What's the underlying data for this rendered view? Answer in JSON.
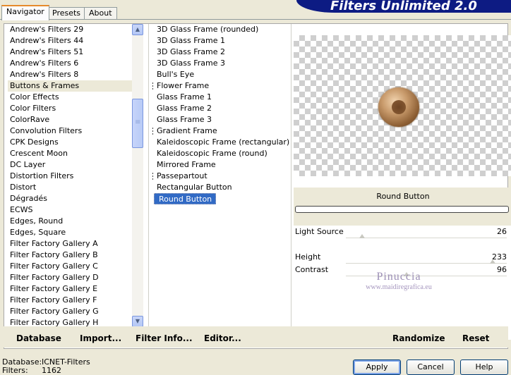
{
  "tabs": [
    {
      "label": "Navigator",
      "active": true
    },
    {
      "label": "Presets",
      "active": false
    },
    {
      "label": "About",
      "active": false
    }
  ],
  "banner": {
    "title": "Filters Unlimited 2.0"
  },
  "categories": {
    "items": [
      "Andrew's Filters 29",
      "Andrew's Filters 44",
      "Andrew's Filters 51",
      "Andrew's Filters 6",
      "Andrew's Filters 8",
      "Buttons & Frames",
      "Color Effects",
      "Color Filters",
      "ColorRave",
      "Convolution Filters",
      "CPK Designs",
      "Crescent Moon",
      "DC Layer",
      "Distortion Filters",
      "Distort",
      "Dégradés",
      "ECWS",
      "Edges, Round",
      "Edges, Square",
      "Filter Factory Gallery A",
      "Filter Factory Gallery B",
      "Filter Factory Gallery C",
      "Filter Factory Gallery D",
      "Filter Factory Gallery E",
      "Filter Factory Gallery F",
      "Filter Factory Gallery G",
      "Filter Factory Gallery H"
    ],
    "selected_index": 5
  },
  "filters": {
    "items": [
      {
        "label": "3D Glass Frame (rounded)",
        "marker": false
      },
      {
        "label": "3D Glass Frame 1",
        "marker": false
      },
      {
        "label": "3D Glass Frame 2",
        "marker": false
      },
      {
        "label": "3D Glass Frame 3",
        "marker": false
      },
      {
        "label": "Bull's Eye",
        "marker": false
      },
      {
        "label": "Flower Frame",
        "marker": true
      },
      {
        "label": "Glass Frame 1",
        "marker": false
      },
      {
        "label": "Glass Frame 2",
        "marker": false
      },
      {
        "label": "Glass Frame 3",
        "marker": false
      },
      {
        "label": "Gradient Frame",
        "marker": true
      },
      {
        "label": "Kaleidoscopic Frame (rectangular)",
        "marker": false
      },
      {
        "label": "Kaleidoscopic Frame (round)",
        "marker": false
      },
      {
        "label": "Mirrored Frame",
        "marker": false
      },
      {
        "label": "Passepartout",
        "marker": true
      },
      {
        "label": "Rectangular Button",
        "marker": false
      },
      {
        "label": "Round Button",
        "marker": false
      }
    ],
    "selected_index": 15
  },
  "preview": {
    "filter_name": "Round Button"
  },
  "sliders": [
    {
      "label": "Light Source",
      "value": "26",
      "level": 26
    },
    {
      "label": "Height",
      "value": "233",
      "level": 233
    },
    {
      "label": "Contrast",
      "value": "96",
      "level": 96
    }
  ],
  "watermark": {
    "line1": "Pinuccia",
    "line2": "www.maidiregrafica.eu"
  },
  "toolbar": {
    "database": "Database",
    "import": "Import...",
    "filter_info": "Filter Info...",
    "editor": "Editor...",
    "randomize": "Randomize",
    "reset": "Reset"
  },
  "status": {
    "database_label": "Database:",
    "database_value": "ICNET-Filters",
    "filters_label": "Filters:",
    "filters_value": "1162"
  },
  "dialog": {
    "apply": "Apply",
    "cancel": "Cancel",
    "help": "Help"
  },
  "colors": {
    "banner": "#0d1b83",
    "selection": "#316ac5",
    "tab_highlight": "#e68b2c"
  }
}
